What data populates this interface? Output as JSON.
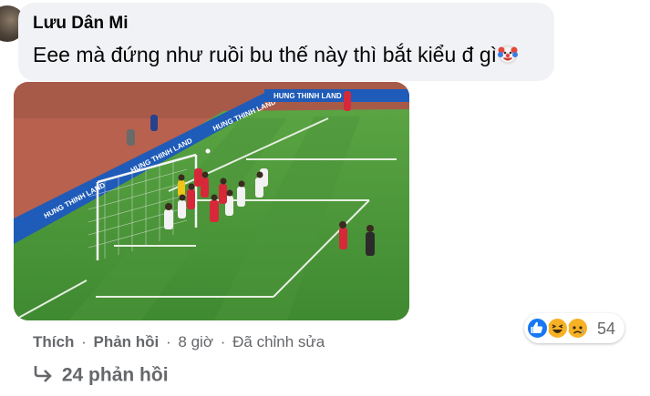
{
  "comment": {
    "author": "Lưu Dân Mi",
    "text": "Eee mà đứng như ruồi bu thế này thì bắt kiểu đ gì",
    "emoji_icon": "clown-face-icon"
  },
  "photo": {
    "ad_board_text": "HUNG THINH LAND",
    "colors": {
      "pitch": "#4f9a3b",
      "pitch_dark": "#3f8430",
      "track": "#c36a55",
      "ad_board": "#1f5bb8"
    }
  },
  "actions": {
    "like": "Thích",
    "reply": "Phản hồi",
    "time": "8 giờ",
    "edited": "Đã chỉnh sửa",
    "separator": "·"
  },
  "reactions": {
    "icons": [
      "like-reaction-icon",
      "haha-reaction-icon",
      "sad-reaction-icon"
    ],
    "count": "54",
    "colors": {
      "like": "#1877f2",
      "haha": "#f7b125",
      "sad": "#f7b125"
    }
  },
  "replies": {
    "label": "24 phản hồi",
    "icon": "reply-arrow-icon"
  }
}
